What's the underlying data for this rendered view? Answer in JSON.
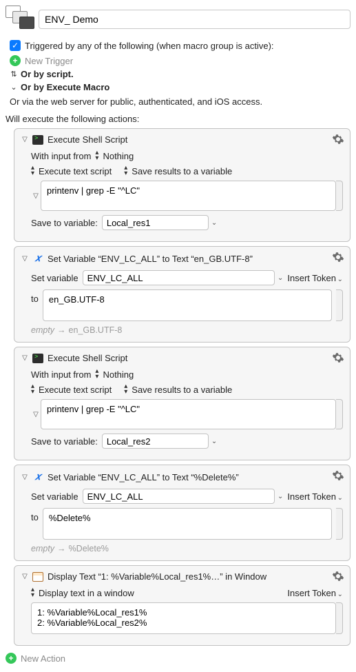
{
  "header": {
    "title_value": "ENV_ Demo"
  },
  "trigger": {
    "label": "Triggered by any of the following (when macro group is active):",
    "new_trigger": "New Trigger",
    "or_script": "Or by script.",
    "or_execute_macro": "Or by Execute Macro",
    "or_web": "Or via the web server for public, authenticated, and iOS access."
  },
  "actions_label": "Will execute the following actions:",
  "common": {
    "with_input_from": "With input from",
    "nothing": "Nothing",
    "execute_text_script": "Execute text script",
    "save_results_var": "Save results to a variable",
    "save_to_variable": "Save to variable:",
    "set_variable": "Set variable",
    "to": "to",
    "empty": "empty",
    "arrow": "→",
    "insert_token": "Insert Token",
    "display_text_window": "Display text in a window",
    "new_action": "New Action"
  },
  "action1": {
    "title": "Execute Shell Script",
    "script": "printenv | grep -E \"^LC\"",
    "save_var": "Local_res1"
  },
  "action2": {
    "title": "Set Variable “ENV_LC_ALL” to Text “en_GB.UTF-8”",
    "var_name": "ENV_LC_ALL",
    "value": "en_GB.UTF-8",
    "footer_left": "empty",
    "footer_right": "en_GB.UTF-8"
  },
  "action3": {
    "title": "Execute Shell Script",
    "script": "printenv | grep -E \"^LC\"",
    "save_var": "Local_res2"
  },
  "action4": {
    "title": "Set Variable “ENV_LC_ALL” to Text “%Delete%”",
    "var_name": "ENV_LC_ALL",
    "value": "%Delete%",
    "footer_left": "empty",
    "footer_right": "%Delete%"
  },
  "action5": {
    "title": "Display Text “1: %Variable%Local_res1%…” in Window",
    "body": "1: %Variable%Local_res1%\n2: %Variable%Local_res2%"
  }
}
